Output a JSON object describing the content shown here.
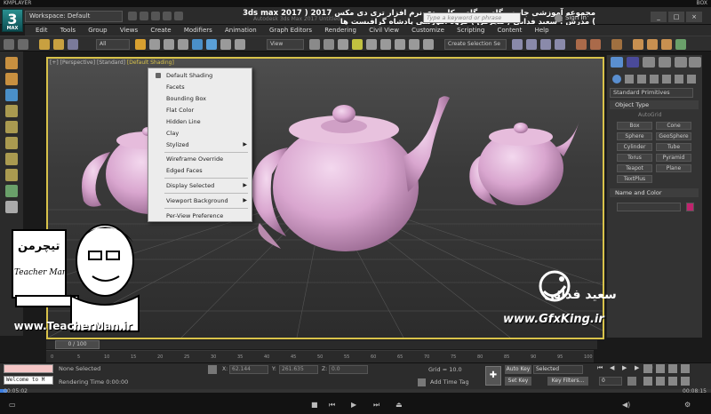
{
  "player": {
    "name": "KMPLAYER",
    "right_label": "BOX",
    "elapsed": "00:05:02",
    "total": "00:08:15",
    "progress": 0.01
  },
  "app": {
    "logo": "3",
    "logo_sub": "MAX",
    "workspace": "Workspace: Default",
    "title_faded": "Autodesk 3ds Max 2017  Untitled",
    "heading": "مجموعه آموزشی جامع ، گام به گام و کاربردی نرم افزار تری دی مکس 2017   ( 3ds max 2017 )   مدرس : سعید فدایی ( تیچرمن ) گروه آموزشی پادشاه گرافیست ها",
    "search_placeholder": "Type a keyword or phrase",
    "sign_in": "Sign In",
    "window_buttons": [
      "_",
      "□",
      "×"
    ]
  },
  "menu": [
    "Edit",
    "Tools",
    "Group",
    "Views",
    "Create",
    "Modifiers",
    "Animation",
    "Graph Editors",
    "Rendering",
    "Civil View",
    "Customize",
    "Scripting",
    "Content",
    "Help"
  ],
  "toolbar": {
    "filter": "All",
    "ref_coord": "View",
    "selection_set": "Create Selection Se"
  },
  "viewport": {
    "label_parts": [
      "[+]",
      "[Perspective]",
      "[Standard]",
      "[Default Shading]"
    ]
  },
  "shading_menu": {
    "items": [
      {
        "label": "Default Shading",
        "checked": true,
        "submenu": false
      },
      {
        "label": "Facets",
        "checked": false,
        "submenu": false
      },
      {
        "label": "Bounding Box",
        "checked": false,
        "submenu": false
      },
      {
        "label": "Flat Color",
        "checked": false,
        "submenu": false
      },
      {
        "label": "Hidden Line",
        "checked": false,
        "submenu": false
      },
      {
        "label": "Clay",
        "checked": false,
        "submenu": false
      },
      {
        "label": "Stylized",
        "checked": false,
        "submenu": true
      },
      {
        "label": "Wireframe Override",
        "checked": false,
        "submenu": false
      },
      {
        "label": "Edged Faces",
        "checked": false,
        "submenu": false
      },
      {
        "label": "Display Selected",
        "checked": false,
        "submenu": true
      },
      {
        "label": "Viewport Background",
        "checked": false,
        "submenu": true
      },
      {
        "label": "Per-View Preference",
        "checked": false,
        "submenu": false
      }
    ]
  },
  "command_panel": {
    "category": "Standard Primitives",
    "rollout_object_type": "Object Type",
    "autogrid": "AutoGrid",
    "buttons": [
      "Box",
      "Cone",
      "Sphere",
      "GeoSphere",
      "Cylinder",
      "Tube",
      "Torus",
      "Pyramid",
      "Teapot",
      "Plane",
      "TextPlus"
    ],
    "rollout_name_color": "Name and Color",
    "object_color": "#c0246e"
  },
  "timeline": {
    "frame": "0 / 100",
    "ticks": [
      "0",
      "5",
      "10",
      "15",
      "20",
      "25",
      "30",
      "35",
      "40",
      "45",
      "50",
      "55",
      "60",
      "65",
      "70",
      "75",
      "80",
      "85",
      "90",
      "95",
      "100"
    ]
  },
  "status": {
    "selection": "None Selected",
    "render_time": "Rendering Time  0:00:00",
    "x_label": "X:",
    "x_value": "62.144",
    "y_label": "Y:",
    "y_value": "261.635",
    "z_label": "Z:",
    "z_value": "0.0",
    "grid": "Grid = 10.0",
    "add_time_tag": "Add Time Tag",
    "auto_key": "Auto Key",
    "set_key": "Set Key",
    "key_mode": "Selected",
    "key_filters": "Key Filters...",
    "frame_value": "0",
    "welcome": "Welcome to M"
  },
  "watermarks": {
    "teacher_fa": "تیچرمن",
    "teacher_en": "Teacher Man",
    "teacher_web": "www.TeacherMan.ir",
    "gfx_name_fa": "سعید فدائی",
    "gfx_web": "www.GfxKing.ir"
  },
  "colors": {
    "accent": "#d8c24a",
    "teapot": "#d9a6cf",
    "selected_tool": "#4a8fc8"
  }
}
